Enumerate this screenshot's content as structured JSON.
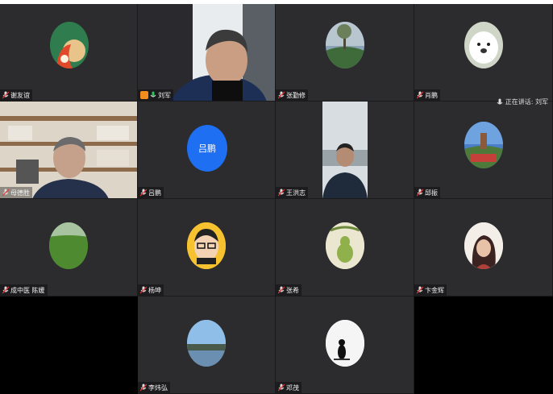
{
  "speaking_label": "正在讲话: 刘军",
  "participants": [
    {
      "name": "谢友谊"
    },
    {
      "name": "刘军"
    },
    {
      "name": "张勤修"
    },
    {
      "name": "肖鹏"
    },
    {
      "name": "母德胜"
    },
    {
      "name": "吕鹏",
      "avatar_text": "吕鹏"
    },
    {
      "name": "王洪志"
    },
    {
      "name": "邱振"
    },
    {
      "name": "成中医 陈媛"
    },
    {
      "name": "杨坤"
    },
    {
      "name": "张希"
    },
    {
      "name": "卞金辉"
    },
    {
      "name": "李炜弘"
    },
    {
      "name": "邓茂"
    }
  ],
  "colors": {
    "tile_bg": "#2c2c2e",
    "avatar_blue": "#1e6ff1",
    "host_badge": "#f28c1e",
    "mic_green": "#2ec15b"
  }
}
